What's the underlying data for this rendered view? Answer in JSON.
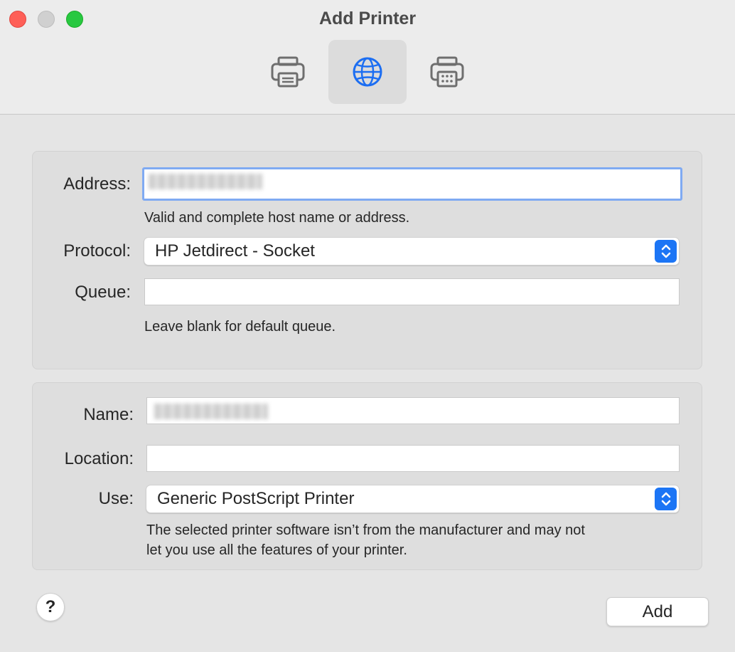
{
  "window": {
    "title": "Add Printer"
  },
  "toolbar": {
    "items": [
      {
        "icon": "printer-icon",
        "selected": false
      },
      {
        "icon": "globe-icon",
        "selected": true
      },
      {
        "icon": "printer-fax-icon",
        "selected": false
      }
    ],
    "accent_color": "#1c6ef2"
  },
  "connection": {
    "address_label": "Address:",
    "address_value_redacted": true,
    "address_hint": "Valid and complete host name or address.",
    "protocol_label": "Protocol:",
    "protocol_value": "HP Jetdirect - Socket",
    "queue_label": "Queue:",
    "queue_value": "",
    "queue_hint": "Leave blank for default queue."
  },
  "printer": {
    "name_label": "Name:",
    "name_value_redacted": true,
    "location_label": "Location:",
    "location_value": "",
    "use_label": "Use:",
    "use_value": "Generic PostScript Printer",
    "use_hint_line1": "The selected printer software isn’t from the manufacturer and may not",
    "use_hint_line2": "let you use all the features of your printer."
  },
  "footer": {
    "help_label": "?",
    "add_label": "Add"
  }
}
